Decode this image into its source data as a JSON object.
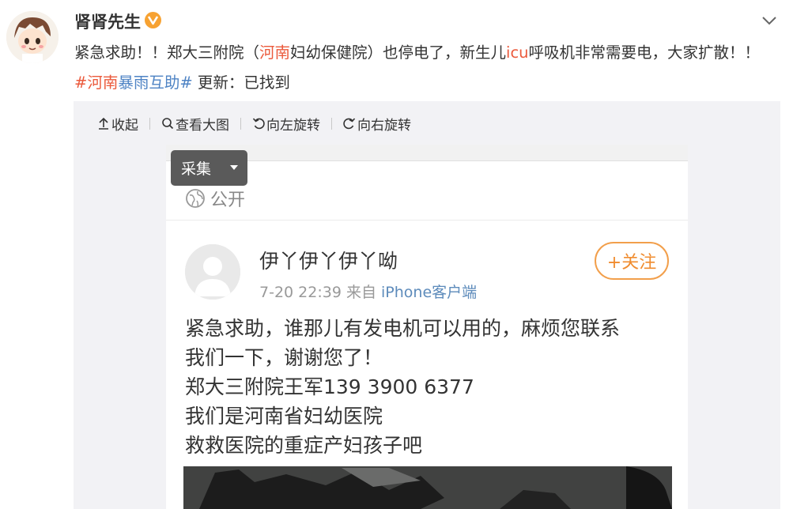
{
  "post": {
    "username": "肾肾先生",
    "text_parts": [
      "紧急求助！！郑大三附院（",
      "河南",
      "妇幼保健院）也停电了，新生儿",
      "icu",
      "呼吸机非常需要电，大家扩散！！ ",
      "#河南",
      "暴雨互助#",
      " 更新：已找到"
    ]
  },
  "toolbar": {
    "collapse": "收起",
    "view_large": "查看大图",
    "rotate_left": "向左旋转",
    "rotate_right": "向右旋转"
  },
  "collect_button": "采集",
  "screenshot": {
    "visibility": "公开",
    "user_name": "伊丫伊丫伊丫呦",
    "timestamp": "7-20 22:39",
    "from_label": "来自",
    "device": "iPhone客户端",
    "follow_label": "+关注",
    "body_lines": [
      "紧急求助，谁那儿有发电机可以用的，麻烦您联系",
      "我们一下，谢谢您了！",
      "郑大三附院王军139 3900 6377",
      "我们是河南省妇幼医院",
      "救救医院的重症产妇孩子吧"
    ]
  },
  "colors": {
    "highlight": "#eb5a3c",
    "hashtag": "#4e83c4",
    "follow": "#f29f4b",
    "verified_badge": "#f7a232"
  },
  "icons": [
    "avatar-cartoon",
    "verified-badge-icon",
    "chevron-down-icon",
    "arrow-up-icon",
    "search-icon",
    "rotate-left-icon",
    "rotate-right-icon",
    "globe-icon",
    "default-avatar-icon"
  ]
}
